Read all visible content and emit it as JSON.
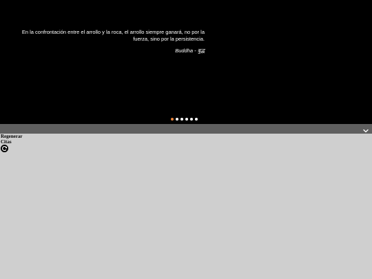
{
  "quote": {
    "text": "En la confrontación entre el arrollo y la roca, el arrollo siempre ganará, no por la fuerza, sino por la persistencia.",
    "author": "Buddha - बुद्ध"
  },
  "carousel": {
    "dot_count": 6,
    "active_index": 0,
    "active_color": "#e8833a",
    "inactive_color": "#ffffff"
  },
  "toolbar": {
    "expand_icon": "chevron-down-icon"
  },
  "regenerate": {
    "label_line1": "Regenerar",
    "label_line2": "Citas",
    "icon": "refresh-icon"
  }
}
